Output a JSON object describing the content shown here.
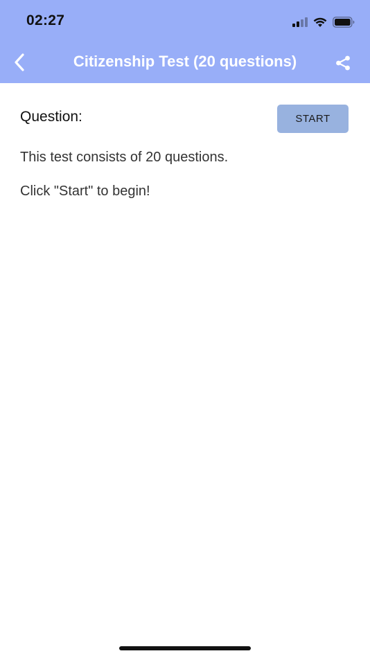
{
  "status_bar": {
    "time": "02:27",
    "icons": [
      "cellular-signal-icon",
      "wifi-icon",
      "battery-icon"
    ]
  },
  "nav": {
    "title": "Citizenship Test (20 questions)",
    "back_icon": "chevron-left-icon",
    "share_icon": "share-icon",
    "background": "#98aef8"
  },
  "main": {
    "question_label": "Question:",
    "start_label": "START",
    "start_color": "#98b2df",
    "info_line_1": "This test consists of 20 questions.",
    "info_line_2": "Click \"Start\" to begin!"
  }
}
